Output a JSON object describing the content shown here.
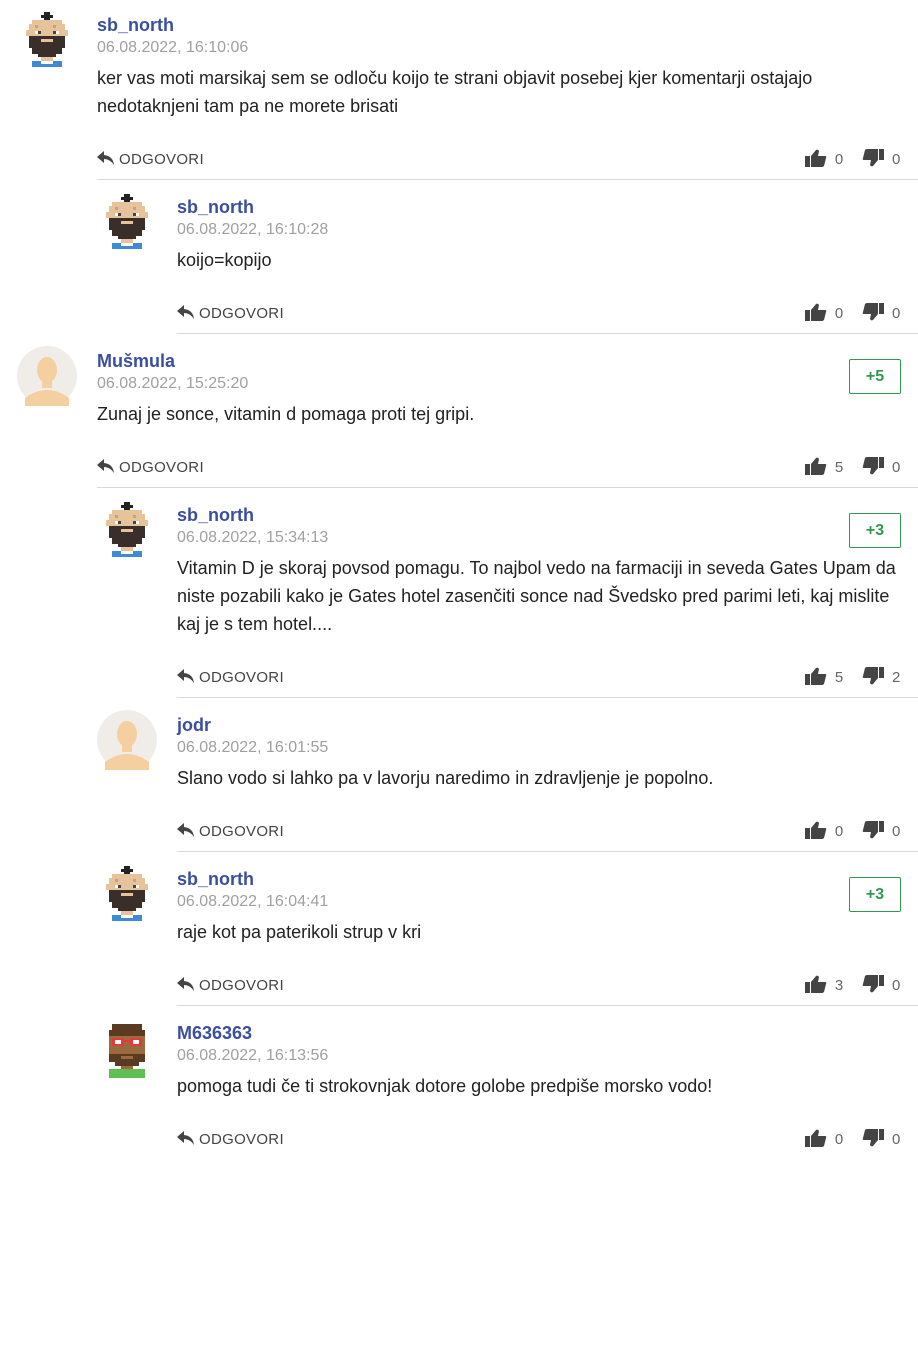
{
  "reply_label": "ODGOVORI",
  "comments": [
    {
      "author": "sb_north",
      "time": "06.08.2022, 16:10:06",
      "text": "ker vas moti marsikaj sem se odloču koijo te strani objavit posebej kjer komentarji ostajajo nedotaknjeni tam pa ne morete brisati",
      "likes": "0",
      "dislikes": "0",
      "score": "",
      "avatar": "pixel-bald-beard-icon"
    },
    {
      "author": "sb_north",
      "time": "06.08.2022, 16:10:28",
      "text": "koijo=kopijo",
      "likes": "0",
      "dislikes": "0",
      "score": "",
      "avatar": "pixel-bald-beard-icon"
    },
    {
      "author": "Mušmula",
      "time": "06.08.2022, 15:25:20",
      "text": "Zunaj je sonce, vitamin d pomaga proti tej gripi.",
      "likes": "5",
      "dislikes": "0",
      "score": "+5",
      "avatar": "default-user-icon"
    },
    {
      "author": "sb_north",
      "time": "06.08.2022, 15:34:13",
      "text": "Vitamin D je skoraj povsod pomagu. To najbol vedo na farmaciji in seveda Gates Upam da niste pozabili kako je Gates hotel zasenčiti sonce nad Švedsko pred parimi leti, kaj mislite kaj je s tem hotel....",
      "likes": "5",
      "dislikes": "2",
      "score": "+3",
      "avatar": "pixel-bald-beard-icon"
    },
    {
      "author": "jodr",
      "time": "06.08.2022, 16:01:55",
      "text": "Slano vodo si lahko pa v lavorju naredimo in zdravljenje je popolno.",
      "likes": "0",
      "dislikes": "0",
      "score": "",
      "avatar": "default-user-icon"
    },
    {
      "author": "sb_north",
      "time": "06.08.2022, 16:04:41",
      "text": "raje kot pa paterikoli strup v kri",
      "likes": "3",
      "dislikes": "0",
      "score": "+3",
      "avatar": "pixel-bald-beard-icon"
    },
    {
      "author": "M636363",
      "time": "06.08.2022, 16:13:56",
      "text": "pomoga tudi če ti strokovnjak dotore golobe predpiše morsko vodo!",
      "likes": "0",
      "dislikes": "0",
      "score": "",
      "avatar": "pixel-glasses-man-icon"
    }
  ],
  "colors": {
    "author": "#3a4fa0",
    "score": "#2f9a4f",
    "time": "#a0a0a0",
    "divider": "#d9d9d9"
  }
}
